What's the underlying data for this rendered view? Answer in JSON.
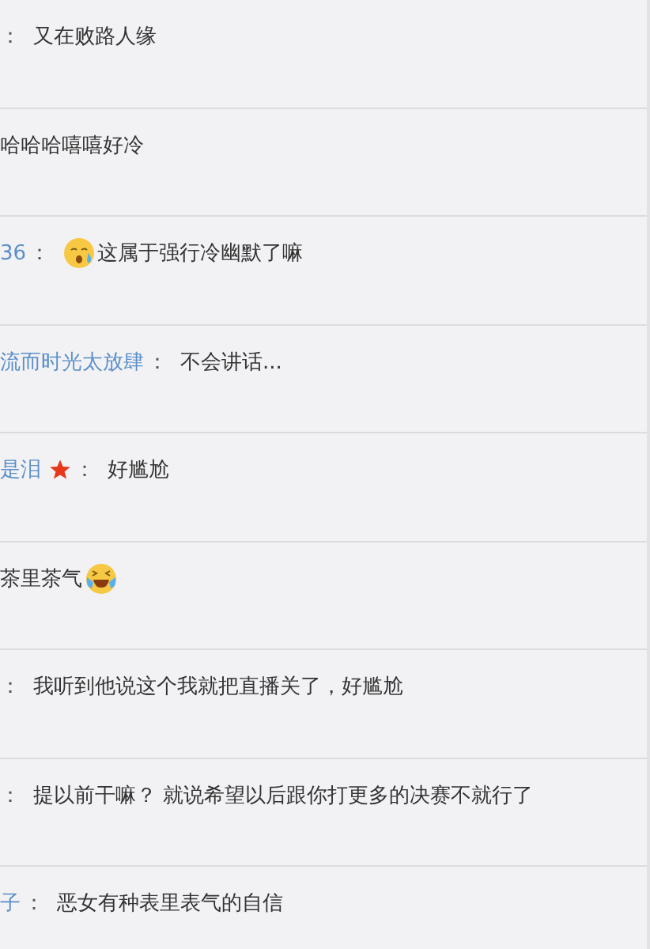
{
  "comments": [
    {
      "colon": "：",
      "text": "又在败路人缘"
    },
    {
      "text": "哈哈哈嘻嘻好冷"
    },
    {
      "user": "36",
      "colon": "：",
      "emoji_before": {
        "kind": "crying"
      },
      "text": "这属于强行冷幽默了嘛"
    },
    {
      "user": "流而时光太放肆",
      "colon": "：",
      "text": "不会讲话..."
    },
    {
      "user": "是泪",
      "badge": {
        "kind": "star"
      },
      "colon": "：",
      "text": "好尴尬"
    },
    {
      "text": "茶里茶气",
      "emoji_after": {
        "kind": "laughing-tears"
      }
    },
    {
      "colon": "：",
      "text": "我听到他说这个我就把直播关了，好尴尬"
    },
    {
      "colon": "：",
      "text": "提以前干嘛？ 就说希望以后跟你打更多的决赛不就行了"
    },
    {
      "user": "子",
      "colon": "：",
      "text": "恶女有种表里表气的自信"
    }
  ]
}
